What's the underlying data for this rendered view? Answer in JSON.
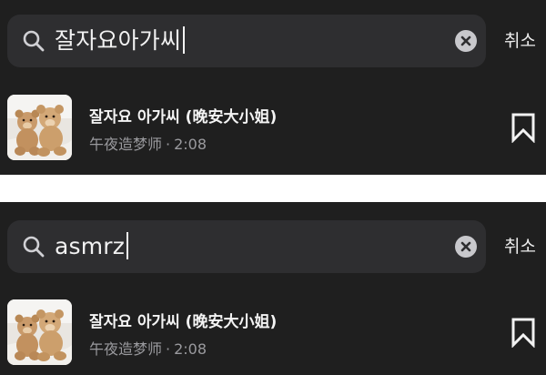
{
  "screens": [
    {
      "search": {
        "query": "잘자요아가씨",
        "clear_icon": "clear-icon"
      },
      "cancel_label": "취소",
      "result": {
        "title": "잘자요 아가씨 (晚安大小姐)",
        "artist": "午夜造梦师",
        "separator": "·",
        "duration": "2:08",
        "thumbnail": "teddy-bears-album-art",
        "bookmark_icon": "bookmark-icon"
      }
    },
    {
      "search": {
        "query": "asmrz",
        "clear_icon": "clear-icon"
      },
      "cancel_label": "취소",
      "result": {
        "title": "잘자요 아가씨 (晚安大小姐)",
        "artist": "午夜造梦师",
        "separator": "·",
        "duration": "2:08",
        "thumbnail": "teddy-bears-album-art",
        "bookmark_icon": "bookmark-icon"
      }
    }
  ],
  "colors": {
    "panel_bg": "#1f1f1f",
    "search_bg": "#2e2e30",
    "text_primary": "#f4f4f4",
    "text_secondary": "#9a9a9e",
    "divider_bg": "#ffffff"
  }
}
